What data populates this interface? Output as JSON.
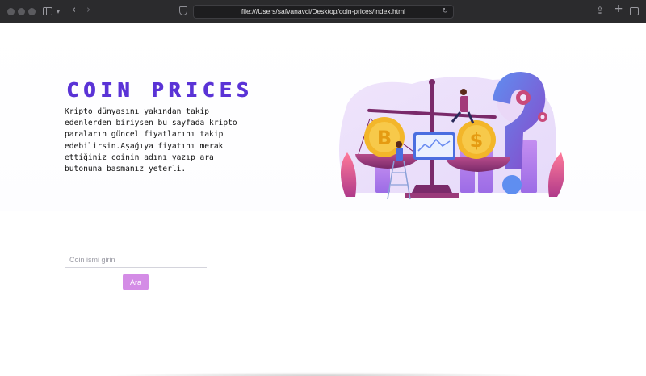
{
  "browser": {
    "url": "file:///Users/safvanavci/Desktop/coin-prices/index.html"
  },
  "page": {
    "title": "COIN PRICES",
    "description": "Kripto dünyasını yakından takip edenlerden biriysen bu sayfada kripto paraların güncel fiyatlarını takip edebilirsin.Aşağıya fiyatını merak ettiğiniz coinin adını yazıp ara butonuna basmanız yeterli.",
    "search": {
      "placeholder": "Coin ismi girin",
      "value": "",
      "button_label": "Ara"
    },
    "illustration": {
      "left_coin_symbol": "B",
      "right_coin_symbol": "$"
    }
  },
  "colors": {
    "title": "#5a33d6",
    "button": "#d48ce6",
    "accent_purple": "#8a46c8",
    "coin_gold": "#f3b62a"
  }
}
